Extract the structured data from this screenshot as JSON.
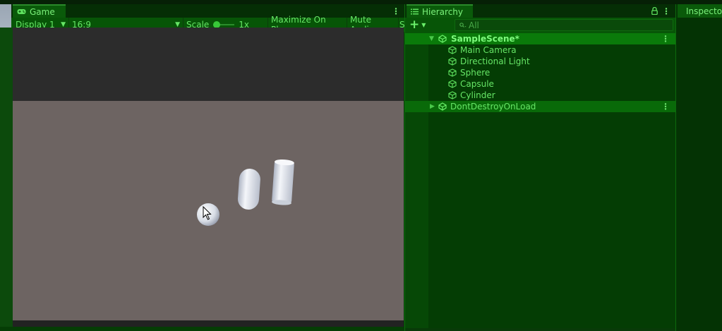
{
  "game": {
    "tab_label": "Game",
    "display": "Display 1",
    "aspect": "16:9",
    "scale_label": "Scale",
    "scale_value": "1x",
    "maximize_label": "Maximize On Play",
    "mute_label": "Mute Audio",
    "overflow_label": "S",
    "scale_fraction": 0.0
  },
  "hierarchy": {
    "tab_label": "Hierarchy",
    "add_label": "+",
    "search_placeholder": "All",
    "scene_name": "SampleScene*",
    "objects": [
      "Main Camera",
      "Directional Light",
      "Sphere",
      "Capsule",
      "Cylinder"
    ],
    "dont_destroy": "DontDestroyOnLoad"
  },
  "inspector": {
    "tab_label": "Inspector"
  },
  "colors": {
    "accent": "#58d858",
    "panel_bg": "#043d04",
    "ground": "#6d6462",
    "sky": "#2c2c2c"
  }
}
